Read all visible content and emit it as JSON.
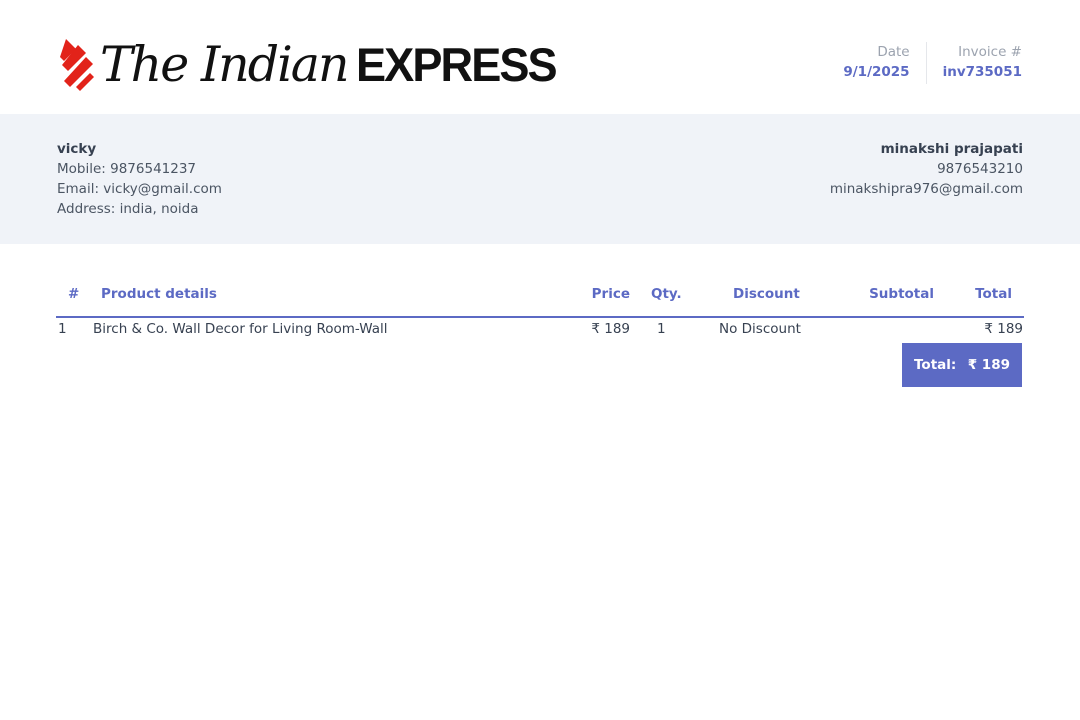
{
  "brand": {
    "name_serif": "The Indian",
    "name_bold": "EXPRESS",
    "mark_color": "#e2231a"
  },
  "meta": {
    "date_label": "Date",
    "date_value": "9/1/2025",
    "invoice_label": "Invoice #",
    "invoice_value": "inv735051"
  },
  "from": {
    "name": "vicky",
    "mobile": "Mobile: 9876541237",
    "email": "Email: vicky@gmail.com",
    "address": "Address: india, noida"
  },
  "to": {
    "name": "minakshi prajapati",
    "phone": "9876543210",
    "email": "minakshipra976@gmail.com"
  },
  "table": {
    "headers": {
      "num": "#",
      "product": "Product details",
      "price": "Price",
      "qty": "Qty.",
      "discount": "Discount",
      "subtotal": "Subtotal",
      "total": "Total"
    },
    "rows": [
      {
        "num": "1",
        "product": "Birch & Co. Wall Decor for Living Room-Wall",
        "price": "₹ 189",
        "qty": "1",
        "discount": "No Discount",
        "subtotal": "",
        "total": "₹ 189"
      }
    ]
  },
  "summary": {
    "total_label": "Total:",
    "total_value": "₹ 189"
  },
  "colors": {
    "accent": "#5c6ac4",
    "band": "#f0f3f8"
  }
}
